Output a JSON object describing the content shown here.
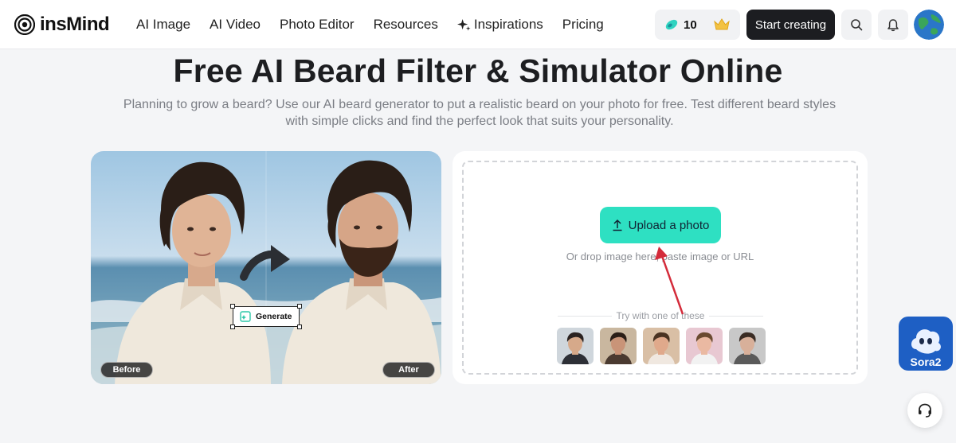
{
  "nav": {
    "logo_text": "insMind",
    "menu": [
      {
        "label": "AI Image"
      },
      {
        "label": "AI Video"
      },
      {
        "label": "Photo Editor"
      },
      {
        "label": "Resources"
      },
      {
        "label": "Inspirations",
        "icon": "sparkle-icon"
      },
      {
        "label": "Pricing"
      }
    ],
    "credits": "10",
    "start_label": "Start creating"
  },
  "hero": {
    "title": "Free AI Beard Filter & Simulator Online",
    "subtitle": "Planning to grow a beard? Use our AI beard generator to put a realistic beard on your photo for free. Test different beard styles with simple clicks and find the perfect look that suits your personality."
  },
  "demo": {
    "before_label": "Before",
    "after_label": "After",
    "generate_label": "Generate"
  },
  "upload": {
    "button_label": "Upload a photo",
    "drop_text": "Or drop image here, paste image or URL",
    "try_text": "Try with one of these",
    "samples": [
      {
        "name": "sample-man-suit",
        "bg": "#cfd6dc",
        "skin": "#d6a98a",
        "hair": "#2a2220",
        "shirt": "#2d2f36"
      },
      {
        "name": "sample-man-dark-hair",
        "bg": "#c9b79f",
        "skin": "#c99478",
        "hair": "#2b1e16",
        "shirt": "#4a3a30"
      },
      {
        "name": "sample-man-smiling",
        "bg": "#d9bfa5",
        "skin": "#e0a98b",
        "hair": "#4a3322",
        "shirt": "#f0e8e0"
      },
      {
        "name": "sample-boy-pink",
        "bg": "#e8c8d2",
        "skin": "#eab9a2",
        "hair": "#6a4a30",
        "shirt": "#f2f2f2"
      },
      {
        "name": "sample-boy-grey",
        "bg": "#c8c8c8",
        "skin": "#d8b09a",
        "hair": "#3a2c24",
        "shirt": "#5a5a5a"
      }
    ]
  },
  "floating": {
    "sora_label": "Sora2"
  },
  "colors": {
    "accent": "#2ee0c2",
    "dark_button": "#1c1d21",
    "arrow": "#d42b3a",
    "sora_bg": "#1e5fc4"
  }
}
